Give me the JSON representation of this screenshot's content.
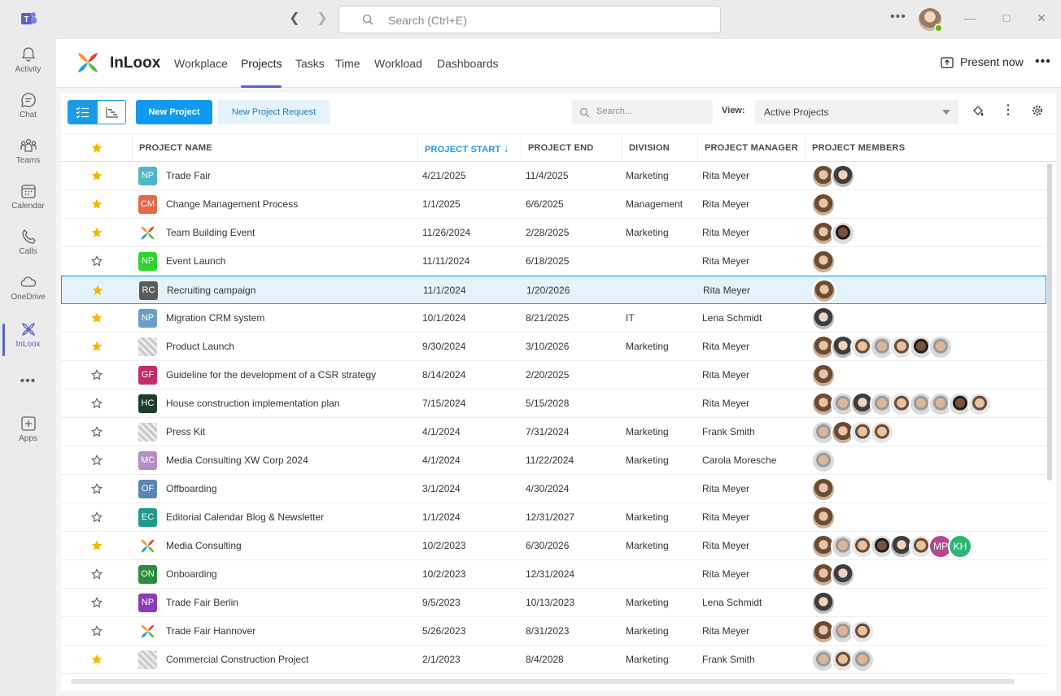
{
  "titlebar": {
    "search_placeholder": "Search (Ctrl+E)"
  },
  "rail": [
    {
      "label": "Activity",
      "icon": "bell-icon"
    },
    {
      "label": "Chat",
      "icon": "chat-icon"
    },
    {
      "label": "Teams",
      "icon": "teams-icon"
    },
    {
      "label": "Calendar",
      "icon": "calendar-icon"
    },
    {
      "label": "Calls",
      "icon": "phone-icon"
    },
    {
      "label": "OneDrive",
      "icon": "cloud-icon"
    },
    {
      "label": "InLoox",
      "icon": "inloox-icon"
    },
    {
      "label": "Apps",
      "icon": "add-app-icon"
    }
  ],
  "app": {
    "name": "InLoox",
    "tabs": [
      "Workplace",
      "Projects",
      "Tasks",
      "Time",
      "Workload",
      "Dashboards"
    ],
    "active_tab": "Projects",
    "present_label": "Present now"
  },
  "toolbar": {
    "new_project": "New Project",
    "new_request": "New Project Request",
    "search_placeholder": "Search...",
    "view_label": "View:",
    "view_value": "Active Projects"
  },
  "columns": {
    "name": "PROJECT NAME",
    "start": "PROJECT START",
    "end": "PROJECT END",
    "division": "DIVISION",
    "manager": "PROJECT MANAGER",
    "members": "PROJECT MEMBERS"
  },
  "colors": {
    "accent": "#1a9be8",
    "teams_purple": "#5b5fc7",
    "star": "#f5b800"
  },
  "rows": [
    {
      "fav": true,
      "icon": "NP",
      "icon_color": "#4db6c8",
      "name": "Trade Fair",
      "start": "4/21/2025",
      "end": "11/4/2025",
      "division": "Marketing",
      "manager": "Rita Meyer",
      "members": [
        "f1",
        "f2"
      ]
    },
    {
      "fav": true,
      "icon": "CM",
      "icon_color": "#e8664a",
      "name": "Change Management Process",
      "start": "1/1/2025",
      "end": "6/6/2025",
      "division": "Management",
      "manager": "Rita Meyer",
      "members": [
        "f1"
      ]
    },
    {
      "fav": true,
      "icon": "logo",
      "icon_color": "",
      "name": "Team Building Event",
      "start": "11/26/2024",
      "end": "2/28/2025",
      "division": "Marketing",
      "manager": "Rita Meyer",
      "members": [
        "f1",
        "m1"
      ]
    },
    {
      "fav": false,
      "icon": "NP",
      "icon_color": "#2dd42d",
      "name": "Event Launch",
      "start": "11/11/2024",
      "end": "6/18/2025",
      "division": "",
      "manager": "Rita Meyer",
      "members": [
        "f1"
      ]
    },
    {
      "fav": true,
      "icon": "RC",
      "icon_color": "#5a5a5a",
      "name": "Recruiting campaign",
      "start": "11/1/2024",
      "end": "1/20/2026",
      "division": "",
      "manager": "Rita Meyer",
      "members": [
        "f1"
      ],
      "selected": true
    },
    {
      "fav": true,
      "icon": "NP",
      "icon_color": "#6a9ec6",
      "name": "Migration CRM system",
      "start": "10/1/2024",
      "end": "8/21/2025",
      "division": "IT",
      "manager": "Lena Schmidt",
      "members": [
        "f2"
      ]
    },
    {
      "fav": true,
      "icon": "photo",
      "icon_color": "",
      "name": "Product Launch",
      "start": "9/30/2024",
      "end": "3/10/2026",
      "division": "Marketing",
      "manager": "Rita Meyer",
      "members": [
        "f1",
        "f2",
        "m2",
        "m3",
        "m2",
        "m1",
        "m3"
      ]
    },
    {
      "fav": false,
      "icon": "GF",
      "icon_color": "#c42a6c",
      "name": "Guideline for the development of a CSR strategy",
      "start": "8/14/2024",
      "end": "2/20/2025",
      "division": "",
      "manager": "Rita Meyer",
      "members": [
        "f1"
      ]
    },
    {
      "fav": false,
      "icon": "HC",
      "icon_color": "#1d3e2a",
      "name": "House construction implementation plan",
      "start": "7/15/2024",
      "end": "5/15/2028",
      "division": "",
      "manager": "Rita Meyer",
      "members": [
        "f1",
        "m3",
        "f2",
        "m3",
        "m2",
        "m3",
        "m3",
        "m1",
        "m2"
      ]
    },
    {
      "fav": false,
      "icon": "photo",
      "icon_color": "",
      "name": "Press Kit",
      "start": "4/1/2024",
      "end": "7/31/2024",
      "division": "Marketing",
      "manager": "Frank Smith",
      "members": [
        "m3",
        "f1",
        "m2",
        "m2"
      ]
    },
    {
      "fav": false,
      "icon": "MC",
      "icon_color": "#b48cc6",
      "name": "Media Consulting XW Corp 2024",
      "start": "4/1/2024",
      "end": "11/22/2024",
      "division": "Marketing",
      "manager": "Carola Moresche",
      "members": [
        "m3"
      ]
    },
    {
      "fav": false,
      "icon": "OF",
      "icon_color": "#5a86b4",
      "name": "Offboarding",
      "start": "3/1/2024",
      "end": "4/30/2024",
      "division": "",
      "manager": "Rita Meyer",
      "members": [
        "f1"
      ]
    },
    {
      "fav": false,
      "icon": "EC",
      "icon_color": "#1f9a8a",
      "name": "Editorial Calendar Blog & Newsletter",
      "start": "1/1/2024",
      "end": "12/31/2027",
      "division": "Marketing",
      "manager": "Rita Meyer",
      "members": [
        "f1"
      ]
    },
    {
      "fav": true,
      "icon": "logo",
      "icon_color": "",
      "name": "Media Consulting",
      "start": "10/2/2023",
      "end": "6/30/2026",
      "division": "Marketing",
      "manager": "Rita Meyer",
      "members": [
        "f1",
        "m3",
        "m2",
        "m1",
        "f2",
        "m2",
        "MP",
        "KH"
      ]
    },
    {
      "fav": false,
      "icon": "ON",
      "icon_color": "#2e8a3c",
      "name": "Onboarding",
      "start": "10/2/2023",
      "end": "12/31/2024",
      "division": "",
      "manager": "Rita Meyer",
      "members": [
        "f1",
        "f2"
      ]
    },
    {
      "fav": false,
      "icon": "NP",
      "icon_color": "#8e3bb8",
      "name": "Trade Fair Berlin",
      "start": "9/5/2023",
      "end": "10/13/2023",
      "division": "Marketing",
      "manager": "Lena Schmidt",
      "members": [
        "f2"
      ]
    },
    {
      "fav": false,
      "icon": "logo",
      "icon_color": "",
      "name": "Trade Fair Hannover",
      "start": "5/26/2023",
      "end": "8/31/2023",
      "division": "Marketing",
      "manager": "Rita Meyer",
      "members": [
        "f1",
        "m3",
        "m2"
      ]
    },
    {
      "fav": true,
      "icon": "photo",
      "icon_color": "",
      "name": "Commercial Construction Project",
      "start": "2/1/2023",
      "end": "8/4/2028",
      "division": "Marketing",
      "manager": "Frank Smith",
      "members": [
        "m3",
        "m2",
        "m3"
      ]
    }
  ],
  "initials_colors": {
    "MP": "#b04a8c",
    "KH": "#2bb673"
  }
}
